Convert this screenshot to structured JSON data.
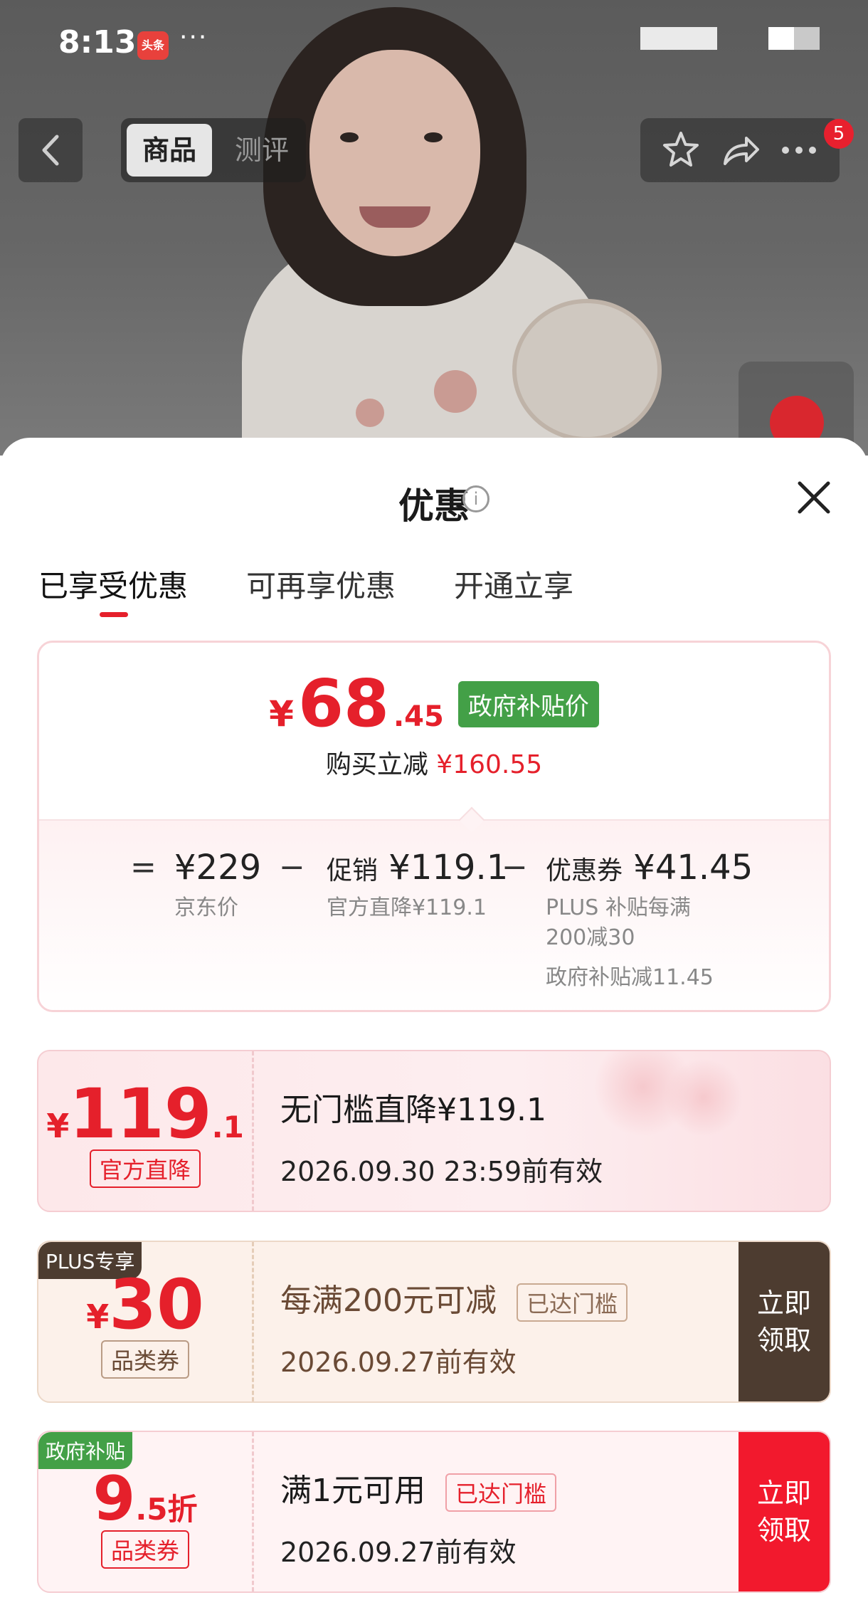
{
  "status_bar": {
    "time": "8:13",
    "app_badge": "头条",
    "more": "···"
  },
  "header": {
    "tabs": [
      {
        "label": "商品",
        "active": true
      },
      {
        "label": "测评",
        "active": false
      }
    ],
    "notification_count": "5"
  },
  "sheet": {
    "title": "优惠",
    "tabs": [
      {
        "label": "已享受优惠",
        "active": true
      },
      {
        "label": "可再享优惠",
        "active": false
      },
      {
        "label": "开通立享",
        "active": false
      }
    ]
  },
  "summary": {
    "price_yen": "¥",
    "price_int": "68",
    "price_dec": ".45",
    "price_tag": "政府补贴价",
    "reduce_label": "购买立减",
    "reduce_amount": "¥160.55",
    "equals": "=",
    "minus": "−",
    "jd_price": "¥229",
    "jd_price_label": "京东价",
    "promo_prefix": "促销",
    "promo_value": "¥119.1",
    "promo_desc": "官方直降¥119.1",
    "coupon_prefix": "优惠券",
    "coupon_value": "¥41.45",
    "coupon_desc_1": "PLUS 补贴每满",
    "coupon_desc_2": "200减30",
    "coupon_desc_3": "政府补贴减11.45"
  },
  "coupons": [
    {
      "yen": "¥",
      "int": "119",
      "dec": ".1",
      "label": "官方直降",
      "title": "无门槛直降¥119.1",
      "date": "2026.09.30 23:59前有效",
      "accent": "#e5202b"
    },
    {
      "ribbon": "PLUS专享",
      "yen": "¥",
      "int": "30",
      "dec": "",
      "label": "品类券",
      "title": "每满200元可减",
      "met": "已达门槛",
      "date": "2026.09.27前有效",
      "claim_1": "立即",
      "claim_2": "领取",
      "accent": "#e5202b",
      "claim_color": "#4d3c30"
    },
    {
      "ribbon": "政府补贴",
      "int": "9",
      "dec": ".5折",
      "label": "品类券",
      "title": "满1元可用",
      "met": "已达门槛",
      "date": "2026.09.27前有效",
      "claim_1": "立即",
      "claim_2": "领取",
      "accent": "#e5202b",
      "claim_color": "#f2192d"
    }
  ]
}
